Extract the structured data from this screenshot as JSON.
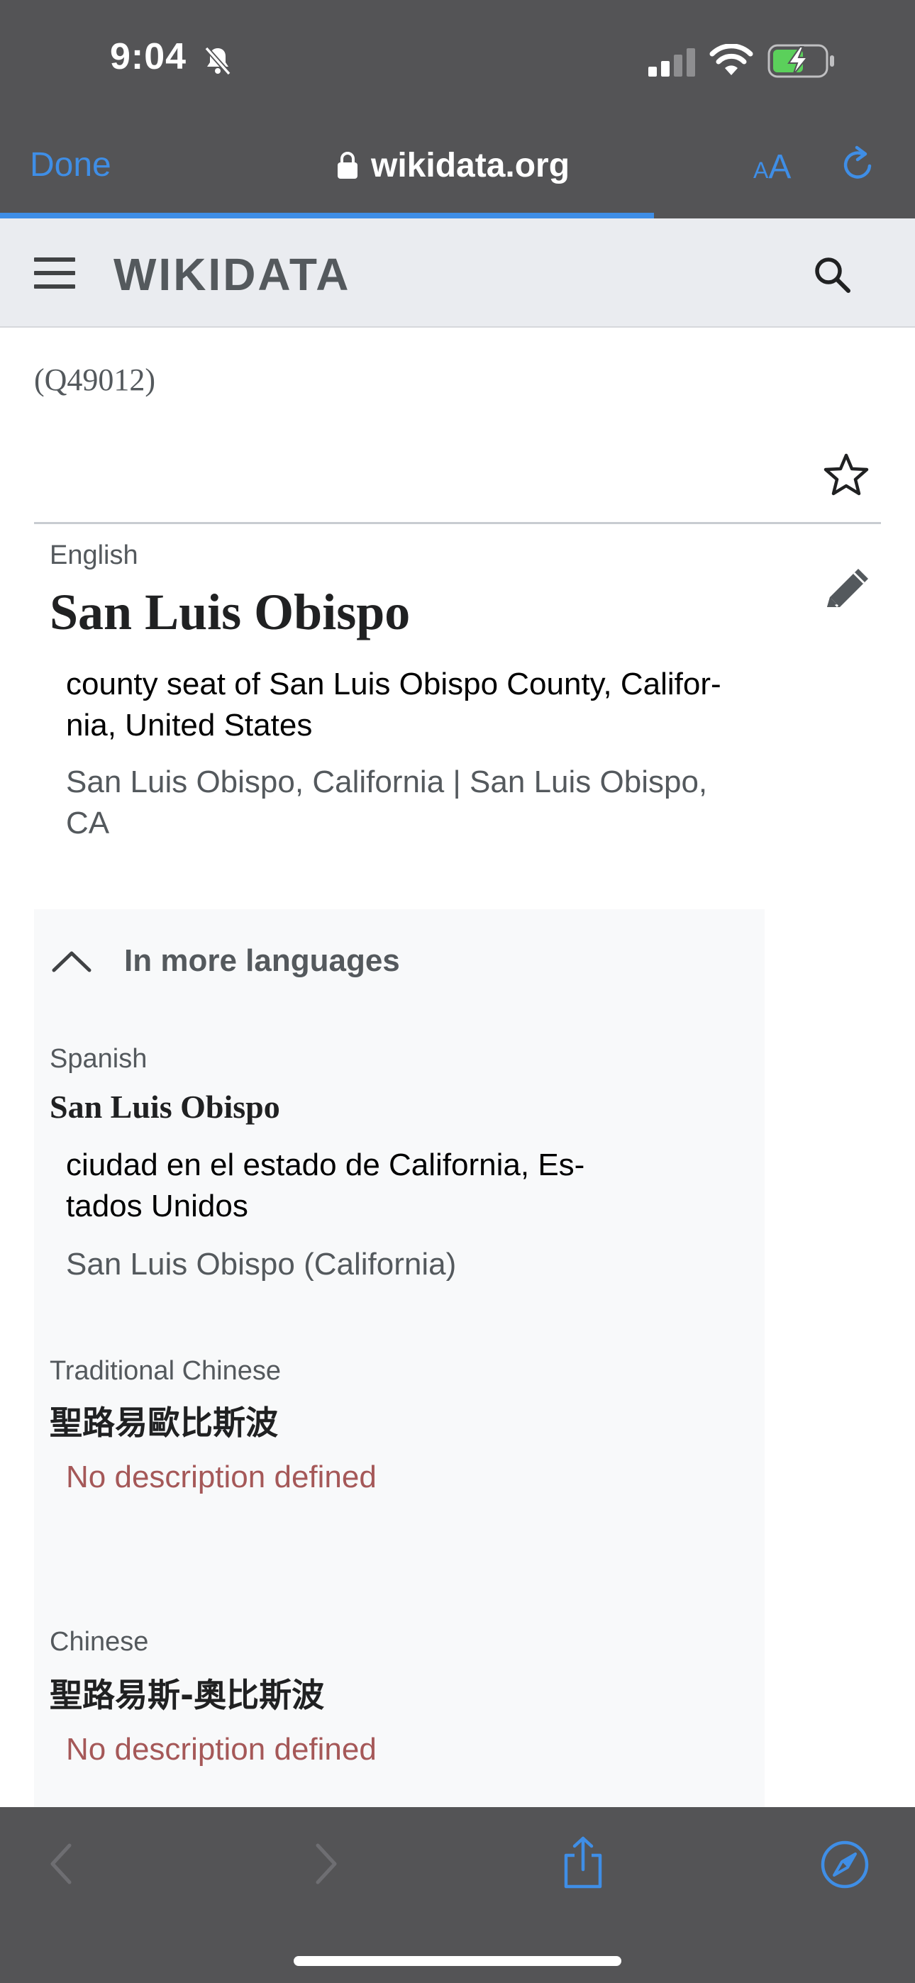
{
  "status_bar": {
    "time": "9:04"
  },
  "safari": {
    "done_label": "Done",
    "url": "wikidata.org",
    "text_size_label_small": "A",
    "text_size_label_large": "A",
    "load_progress_percent": 71.5
  },
  "header": {
    "logo": "WIKIDATA"
  },
  "item": {
    "id": "(Q49012)"
  },
  "english": {
    "language": "English",
    "label": "San Luis Obispo",
    "description_line1": "county seat of San Luis Obispo County, Califor-",
    "description_line2": "nia, United States",
    "aliases_line1": "San Luis Obispo, California | San Luis Obispo,",
    "aliases_line2": "CA"
  },
  "more_languages": {
    "title": "In more languages",
    "entries": [
      {
        "language": "Spanish",
        "label": "San Luis Obispo",
        "description_line1": "ciudad en el estado de California, Es-",
        "description_line2": "tados Unidos",
        "aliases": "San Luis Obispo (California)"
      },
      {
        "language": "Traditional Chinese",
        "label": "聖路易歐比斯波",
        "description": "No description defined"
      },
      {
        "language": "Chinese",
        "label": "聖路易斯-奧比斯波",
        "description": "No description defined"
      }
    ]
  },
  "colors": {
    "safari_bar": "#545456",
    "accent_blue": "#3f8ee6",
    "header_bg": "#eaecf0",
    "no_description": "#a55858",
    "battery_charging": "#5bd05b"
  }
}
